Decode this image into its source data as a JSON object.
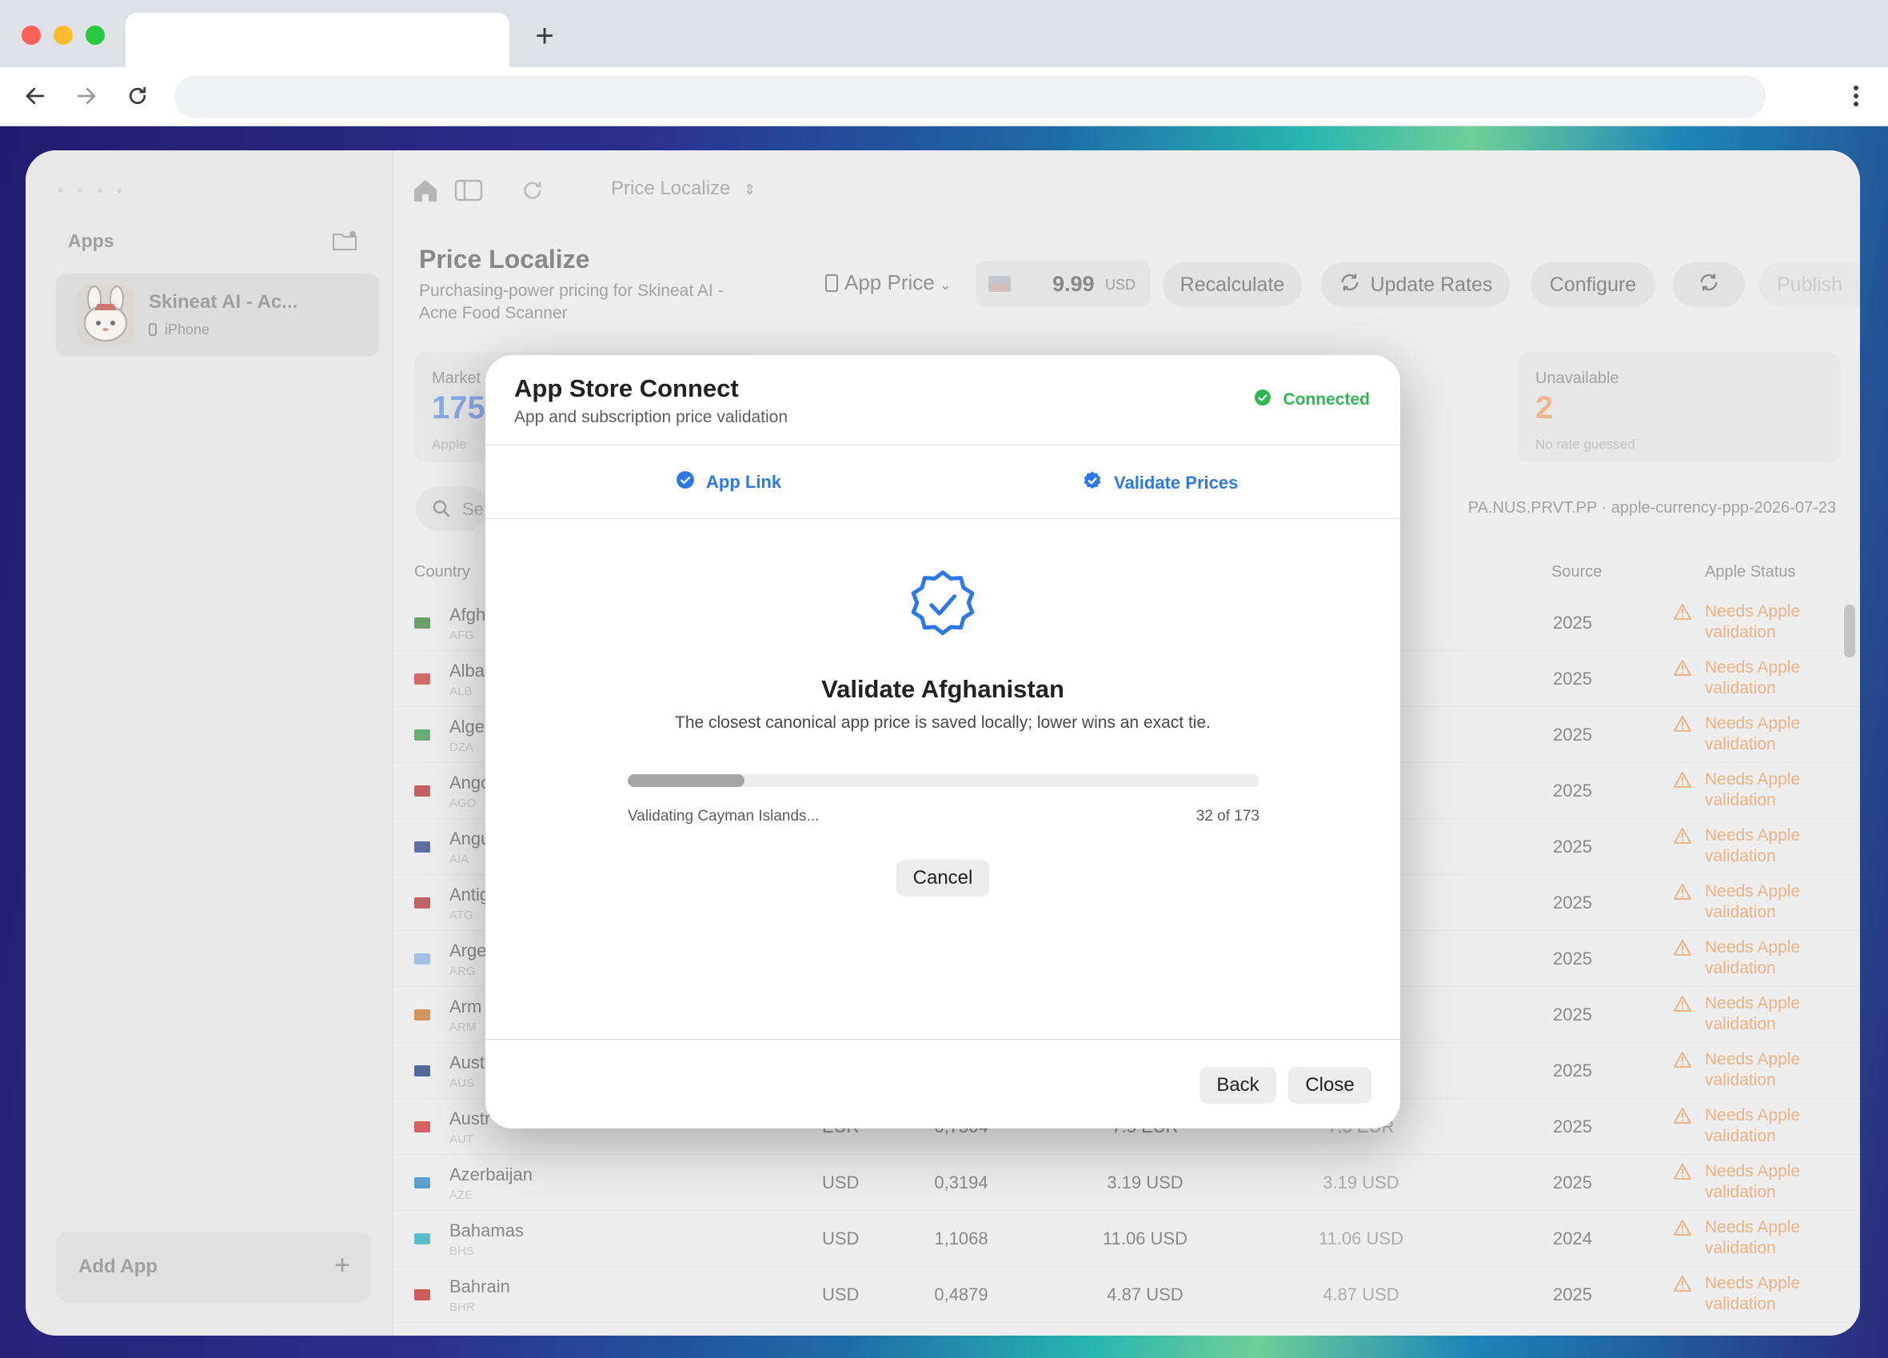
{
  "browser": {
    "new_tab_symbol": "+"
  },
  "sidebar": {
    "dots": "• • • •",
    "apps_title": "Apps",
    "app_name": "Skineat AI - Ac...",
    "app_platform": "iPhone",
    "add_app_label": "Add App",
    "add_app_plus": "+"
  },
  "header": {
    "breadcrumb": "Price Localize",
    "title": "Price Localize",
    "subtitle": "Purchasing-power pricing for Skineat AI - Acne Food Scanner",
    "price_selector": "App Price",
    "price_value": "9.99",
    "price_currency": "USD",
    "recalculate": "Recalculate",
    "update_rates": "Update Rates",
    "configure": "Configure",
    "publish": "Publish"
  },
  "stats": [
    {
      "label": "Market",
      "value": "175",
      "note": "Apple",
      "color": "#7096e0"
    },
    {
      "label": "Unavailable",
      "value": "2",
      "note": "No rate guessed",
      "color": "#e8a878"
    }
  ],
  "search": {
    "placeholder": "Se"
  },
  "rates_source": "PA.NUS.PRVT.PP · apple-currency-ppp-2026-07-23",
  "table": {
    "headers": {
      "country": "Country",
      "source": "Source",
      "apple_status": "Apple Status"
    },
    "rows": [
      {
        "name": "Afgh",
        "code": "AFG",
        "currency": "",
        "rate": "",
        "local": "",
        "apple": "",
        "source": "2025",
        "status": "Needs Apple validation",
        "flag": "#4a8a4a"
      },
      {
        "name": "Alba",
        "code": "ALB",
        "currency": "",
        "rate": "",
        "local": "",
        "apple": "",
        "source": "2025",
        "status": "Needs Apple validation",
        "flag": "#c84a4a"
      },
      {
        "name": "Alge",
        "code": "DZA",
        "currency": "",
        "rate": "",
        "local": "",
        "apple": "",
        "source": "2025",
        "status": "Needs Apple validation",
        "flag": "#4a9a5a"
      },
      {
        "name": "Ango",
        "code": "AGO",
        "currency": "",
        "rate": "",
        "local": "",
        "apple": "",
        "source": "2025",
        "status": "Needs Apple validation",
        "flag": "#b84040"
      },
      {
        "name": "Angu",
        "code": "AIA",
        "currency": "",
        "rate": "",
        "local": "",
        "apple": "",
        "source": "2025",
        "status": "Needs Apple validation",
        "flag": "#3c4e8a"
      },
      {
        "name": "Antig",
        "code": "ATG",
        "currency": "",
        "rate": "",
        "local": "",
        "apple": "",
        "source": "2025",
        "status": "Needs Apple validation",
        "flag": "#b04040"
      },
      {
        "name": "Arge",
        "code": "ARG",
        "currency": "",
        "rate": "",
        "local": "",
        "apple": "",
        "source": "2025",
        "status": "Needs Apple validation",
        "flag": "#8ab4e0"
      },
      {
        "name": "Arm",
        "code": "ARM",
        "currency": "",
        "rate": "",
        "local": "",
        "apple": "",
        "source": "2025",
        "status": "Needs Apple validation",
        "flag": "#c87a3a"
      },
      {
        "name": "Aust",
        "code": "AUS",
        "currency": "",
        "rate": "",
        "local": "",
        "apple": "",
        "source": "2025",
        "status": "Needs Apple validation",
        "flag": "#2e4a8a"
      },
      {
        "name": "Austr",
        "code": "AUT",
        "currency": "EUR",
        "rate": "0,7504",
        "local": "7.5 EUR",
        "apple": "7.5 EUR",
        "source": "2025",
        "status": "Needs Apple validation",
        "flag": "#c84040"
      },
      {
        "name": "Azerbaijan",
        "code": "AZE",
        "currency": "USD",
        "rate": "0,3194",
        "local": "3.19 USD",
        "apple": "3.19 USD",
        "source": "2025",
        "status": "Needs Apple validation",
        "flag": "#3a8ac0"
      },
      {
        "name": "Bahamas",
        "code": "BHS",
        "currency": "USD",
        "rate": "1,1068",
        "local": "11.06 USD",
        "apple": "11.06 USD",
        "source": "2024",
        "status": "Needs Apple validation",
        "flag": "#3ab0c0"
      },
      {
        "name": "Bahrain",
        "code": "BHR",
        "currency": "USD",
        "rate": "0,4879",
        "local": "4.87 USD",
        "apple": "4.87 USD",
        "source": "2025",
        "status": "Needs Apple validation",
        "flag": "#c03a3a"
      }
    ]
  },
  "modal": {
    "title": "App Store Connect",
    "subtitle": "App and subscription price validation",
    "connection_status": "Connected",
    "steps": {
      "app_link": "App Link",
      "validate_prices": "Validate Prices"
    },
    "heading": "Validate Afghanistan",
    "description": "The closest canonical app price is saved locally; lower wins an exact tie.",
    "progress_label": "Validating Cayman Islands...",
    "progress_count": "32 of 173",
    "progress_fraction": 0.185,
    "cancel": "Cancel",
    "back": "Back",
    "close": "Close"
  },
  "colors": {
    "accent": "#2d78e6",
    "connected": "#2fb653",
    "warning": "#e6a26b"
  },
  "icons": [
    "back-arrow-icon",
    "forward-arrow-icon",
    "reload-icon",
    "more-icon",
    "home-icon",
    "sidebar-toggle-icon",
    "refresh-icon",
    "check-badge-icon",
    "sync-icon",
    "warning-icon"
  ]
}
